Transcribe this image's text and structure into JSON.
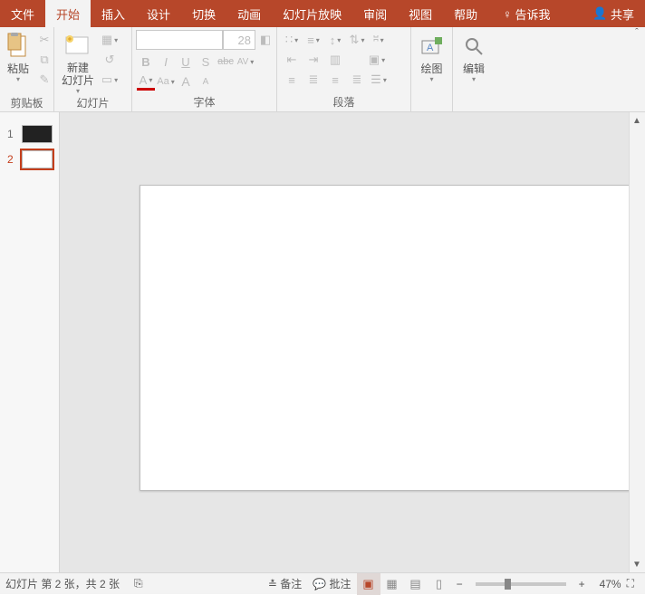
{
  "tabs": {
    "file": "文件",
    "home": "开始",
    "insert": "插入",
    "design": "设计",
    "trans": "切换",
    "anim": "动画",
    "show": "幻灯片放映",
    "review": "审阅",
    "view": "视图",
    "help": "帮助",
    "tell": "告诉我",
    "share": "共享"
  },
  "groups": {
    "clipboard": "剪贴板",
    "slides": "幻灯片",
    "font": "字体",
    "paragraph": "段落",
    "drawing": "绘图",
    "editing": "编辑"
  },
  "buttons": {
    "paste": "粘贴",
    "newSlide": "新建\n幻灯片",
    "drawing": "绘图",
    "editing": "编辑"
  },
  "font": {
    "size": "28"
  },
  "fontBtns": {
    "bold": "B",
    "italic": "I",
    "underline": "U",
    "shadow": "S",
    "strike": "abc",
    "spacing": "AV",
    "colorA": "A",
    "caseAa": "Aa",
    "grow": "A",
    "shrink": "A"
  },
  "thumbs": [
    {
      "n": "1"
    },
    {
      "n": "2"
    }
  ],
  "status": {
    "slideInfo": "幻灯片 第 2 张，共 2 张",
    "notes": "备注",
    "comments": "批注",
    "zoom": "47%"
  }
}
